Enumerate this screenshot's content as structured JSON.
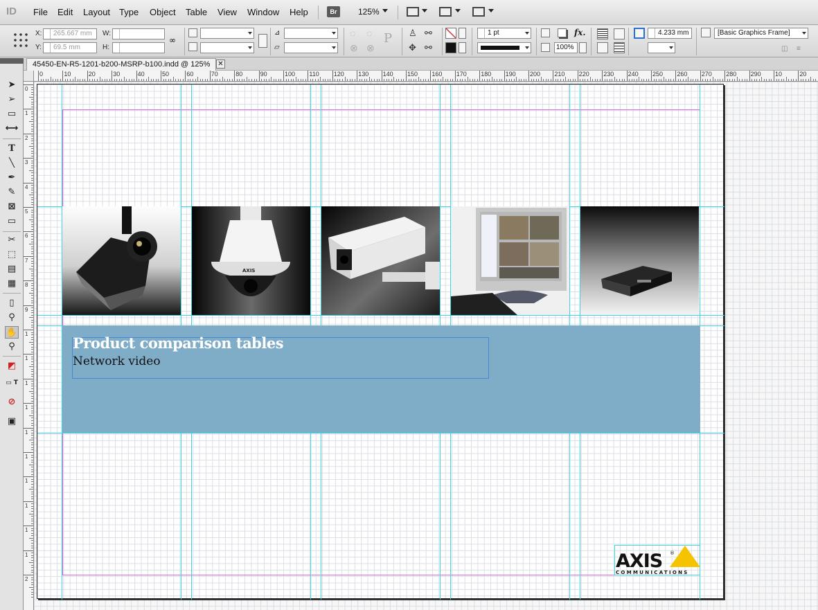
{
  "app": {
    "logo": "ID"
  },
  "menu": [
    "File",
    "Edit",
    "Layout",
    "Type",
    "Object",
    "Table",
    "View",
    "Window",
    "Help"
  ],
  "menubar": {
    "bridge_label": "Br",
    "zoom": "125%"
  },
  "control": {
    "x_label": "X:",
    "x_value": "265.667 mm",
    "y_label": "Y:",
    "y_value": "69.5 mm",
    "w_label": "W:",
    "h_label": "H:",
    "stroke_weight": "1 pt",
    "offset": "4.233 mm",
    "opacity": "100%",
    "object_style": "[Basic Graphics Frame]"
  },
  "tab": {
    "title": "45450-EN-R5-1201-b200-MSRP-b100.indd @ 125%",
    "close": "✕"
  },
  "hruler_labels": [
    "0",
    "10",
    "20",
    "30",
    "40",
    "50",
    "60",
    "70",
    "80",
    "90",
    "100",
    "110",
    "120",
    "130",
    "140",
    "150",
    "160",
    "170",
    "180",
    "190",
    "200",
    "210",
    "220",
    "230",
    "240",
    "250",
    "260",
    "270",
    "280",
    "290",
    "10",
    "20",
    "30"
  ],
  "vruler_labels": [
    "0",
    "1",
    "2",
    "3",
    "4",
    "5",
    "6",
    "7",
    "8",
    "9",
    "1",
    "1",
    "1",
    "1",
    "1",
    "1",
    "1",
    "1",
    "1",
    "1",
    "2"
  ],
  "page": {
    "title": "Product comparison tables",
    "subtitle": "Network video",
    "logo_text": "AXIS",
    "logo_subtext": "COMMUNICATIONS",
    "logo_reg": "®"
  },
  "photos": [
    "ceiling-mount-camera",
    "ptz-dome-camera",
    "outdoor-housing-camera",
    "monitor-software",
    "video-encoder"
  ],
  "colors": {
    "band": "#7facc7",
    "guide": "#39d6e6",
    "margin": "#d66ad6",
    "logo_yellow": "#f5c400"
  }
}
